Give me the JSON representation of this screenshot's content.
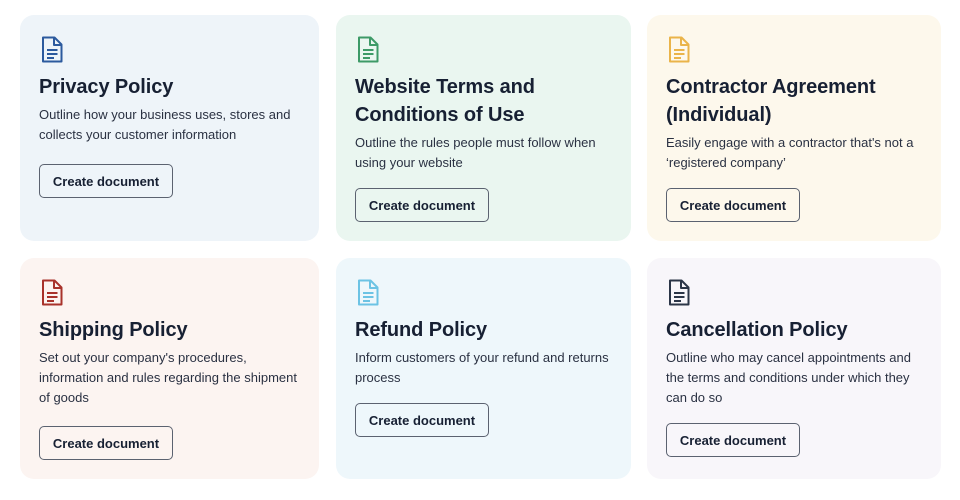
{
  "button_label": "Create document",
  "cards": [
    {
      "title": "Privacy Policy",
      "description": "Outline how your business uses, stores and collects your customer information",
      "icon": "document-icon",
      "icon_color": "#2c5a9e",
      "background": "#eef4f9"
    },
    {
      "title": "Website Terms and Conditions of Use",
      "description": "Outline the rules people must follow when using your website",
      "icon": "document-icon",
      "icon_color": "#3d9a67",
      "background": "#eaf6f0"
    },
    {
      "title": "Contractor Agreement (Individual)",
      "description": "Easily engage with a contractor that's not a ‘registered company’",
      "icon": "document-icon",
      "icon_color": "#eab44a",
      "background": "#fdf8ec"
    },
    {
      "title": "Shipping Policy",
      "description": "Set out your company's procedures, information and rules regarding the shipment of goods",
      "icon": "document-icon",
      "icon_color": "#a8322b",
      "background": "#fcf4f1"
    },
    {
      "title": "Refund Policy",
      "description": "Inform customers of your refund and returns process",
      "icon": "document-icon",
      "icon_color": "#6cc3e4",
      "background": "#eef7fb"
    },
    {
      "title": "Cancellation Policy",
      "description": "Outline who may cancel appointments and the terms and conditions under which they can do so",
      "icon": "document-icon",
      "icon_color": "#2b3547",
      "background": "#f8f6fa"
    }
  ]
}
